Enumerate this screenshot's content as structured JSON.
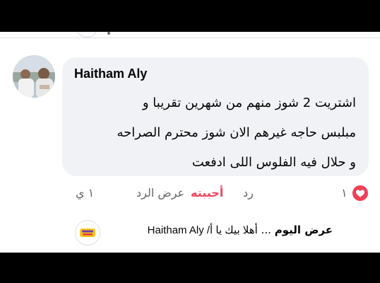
{
  "comment": {
    "author": "Haitham Aly",
    "text_lines": [
      "اشتريت 2 شوز منهم من شهرين تقريبا و",
      "مبلبس حاجه غيرهم الان شوز محترم الصراحه",
      "و حلال فيه الفلوس اللى ادفعت"
    ],
    "reaction_count": "١",
    "reaction_icon": "heart-icon"
  },
  "actions": {
    "reply": "رد",
    "liked": "أحببته",
    "show_offer": "عرض الرد",
    "time": "١ ي"
  },
  "reply_preview": {
    "author": "عرض اليوم",
    "ellipsis": "...",
    "text": "أهلا بيك يا أ/  Haitham  Aly"
  },
  "colors": {
    "bubble": "#f0f2f5",
    "liked": "#f3425f",
    "secondary_text": "#65676b"
  }
}
